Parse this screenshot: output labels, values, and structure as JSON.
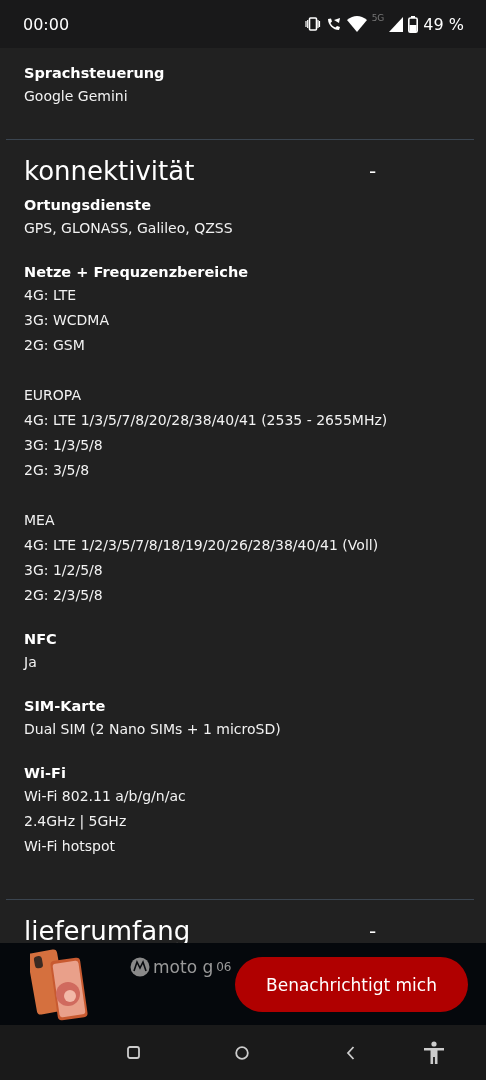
{
  "status_bar": {
    "time": "00:00",
    "network": "5G",
    "battery": "49 %"
  },
  "top_spec": {
    "label": "Sprachsteuerung",
    "blocks": [
      [
        "Google Gemini"
      ]
    ]
  },
  "sections": [
    {
      "title": "konnektivität",
      "toggle": "-",
      "specs": [
        {
          "label": "Ortungsdienste",
          "blocks": [
            [
              "GPS, GLONASS, Galileo, QZSS"
            ]
          ]
        },
        {
          "label": "Netze + Frequzenzbereiche",
          "blocks": [
            [
              "4G: LTE",
              "3G: WCDMA",
              "2G: GSM"
            ],
            [
              "EUROPA",
              "4G: LTE 1/3/5/7/8/20/28/38/40/41 (2535 - 2655MHz)",
              "3G: 1/3/5/8",
              "2G: 3/5/8"
            ],
            [
              "MEA",
              "4G: LTE 1/2/3/5/7/8/18/19/20/26/28/38/40/41 (Voll)",
              "3G: 1/2/5/8",
              "2G: 2/3/5/8"
            ]
          ]
        },
        {
          "label": "NFC",
          "blocks": [
            [
              "Ja"
            ]
          ]
        },
        {
          "label": "SIM-Karte",
          "blocks": [
            [
              "Dual SIM (2 Nano SIMs + 1 microSD)"
            ]
          ]
        },
        {
          "label": "Wi-Fi",
          "blocks": [
            [
              "Wi-Fi 802.11 a/b/g/n/ac",
              "2.4GHz | 5GHz",
              "Wi-Fi hotspot"
            ]
          ]
        }
      ]
    },
    {
      "title": "lieferumfang",
      "toggle": "-"
    }
  ],
  "sticky_bar": {
    "brand": "moto g",
    "model": "06",
    "button": "Benachrichtigt mich"
  }
}
